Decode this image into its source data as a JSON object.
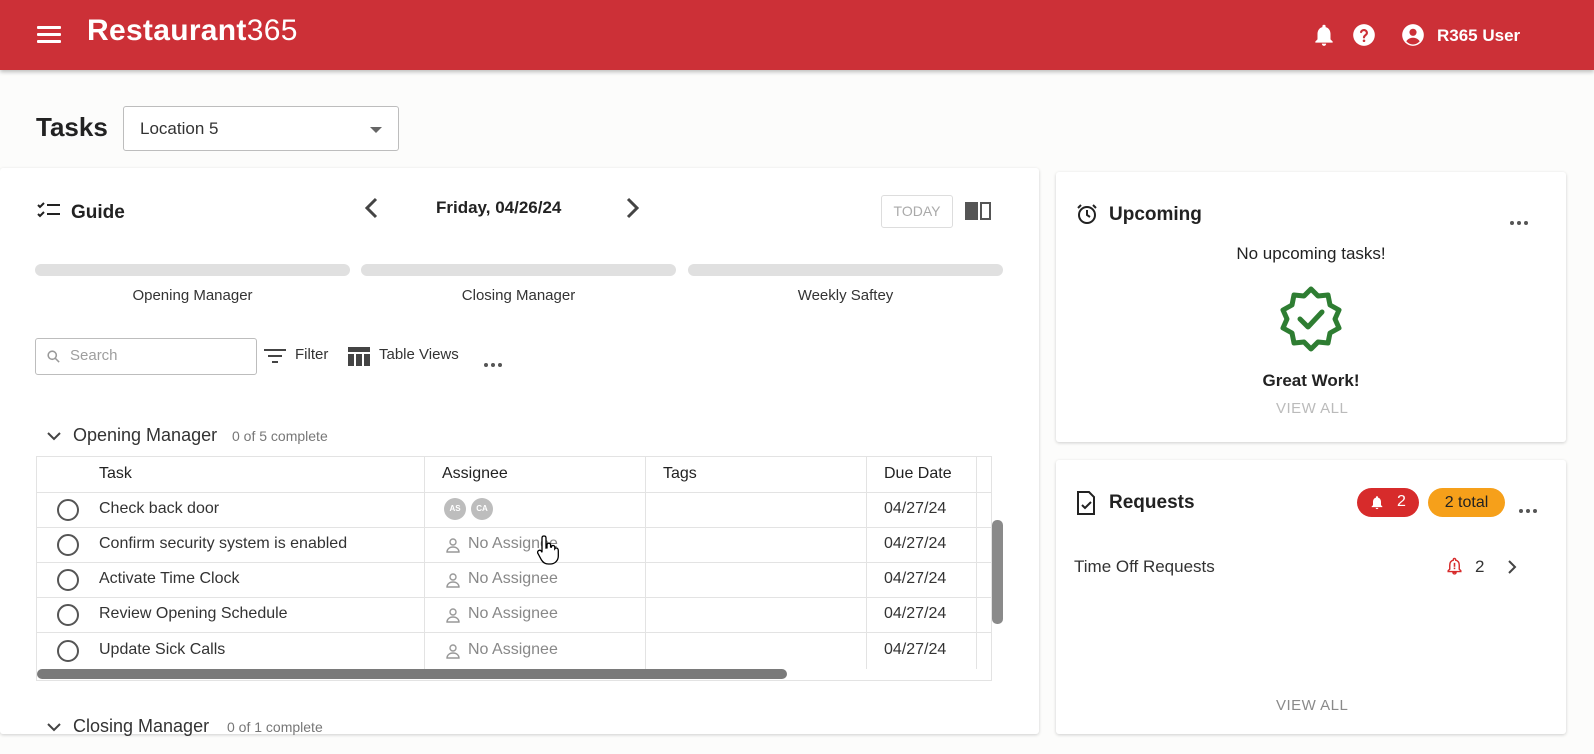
{
  "header": {
    "brand_bold": "Restaurant",
    "brand_thin": "365",
    "user_name": "R365 User"
  },
  "page": {
    "title": "Tasks",
    "location_selected": "Location 5"
  },
  "guide": {
    "title": "Guide",
    "date": "Friday, 04/26/24",
    "today_label": "TODAY",
    "progress": [
      {
        "label": "Opening Manager",
        "fraction": 0
      },
      {
        "label": "Closing Manager",
        "fraction": 0
      },
      {
        "label": "Weekly Saftey",
        "fraction": 0
      }
    ],
    "search_placeholder": "Search",
    "filter_label": "Filter",
    "table_views_label": "Table Views"
  },
  "groups": [
    {
      "name": "Opening Manager",
      "count": "0 of 5 complete"
    },
    {
      "name": "Closing Manager",
      "count": "0 of 1 complete"
    }
  ],
  "table": {
    "headers": [
      "Task",
      "Assignee",
      "Tags",
      "Due Date"
    ],
    "rows": [
      {
        "task": "Check back door",
        "assignee": "",
        "avatars": [
          "AS",
          "CA"
        ],
        "tags": "",
        "due": "04/27/24"
      },
      {
        "task": "Confirm security system is enabled",
        "assignee": "No Assignee",
        "tags": "",
        "due": "04/27/24"
      },
      {
        "task": "Activate Time Clock",
        "assignee": "No Assignee",
        "tags": "",
        "due": "04/27/24"
      },
      {
        "task": "Review Opening Schedule",
        "assignee": "No Assignee",
        "tags": "",
        "due": "04/27/24"
      },
      {
        "task": "Update Sick Calls",
        "assignee": "No Assignee",
        "tags": "",
        "due": "04/27/24"
      }
    ]
  },
  "upcoming": {
    "title": "Upcoming",
    "empty_text": "No upcoming tasks!",
    "great_work": "Great Work!",
    "view_all": "VIEW ALL"
  },
  "requests": {
    "title": "Requests",
    "alert_count": "2",
    "total_label": "2 total",
    "item_label": "Time Off Requests",
    "item_count": "2",
    "view_all": "VIEW ALL"
  },
  "colors": {
    "brand_red": "#cc3037",
    "success_green": "#2e7d32",
    "badge_red": "#d72b2b",
    "badge_orange": "#f6a01a"
  }
}
